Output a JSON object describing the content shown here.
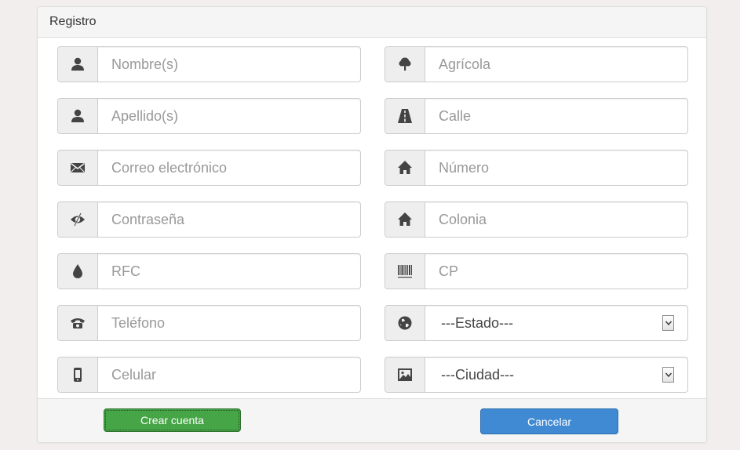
{
  "panel": {
    "title": "Registro"
  },
  "left_fields": [
    {
      "icon": "user-icon",
      "placeholder": "Nombre(s)"
    },
    {
      "icon": "user-icon",
      "placeholder": "Apellido(s)"
    },
    {
      "icon": "envelope-icon",
      "placeholder": "Correo electrónico"
    },
    {
      "icon": "eye-slash-icon",
      "placeholder": "Contraseña"
    },
    {
      "icon": "drop-icon",
      "placeholder": "RFC"
    },
    {
      "icon": "phone-icon",
      "placeholder": "Teléfono"
    },
    {
      "icon": "mobile-phone-icon",
      "placeholder": "Celular"
    }
  ],
  "right_fields": [
    {
      "icon": "tree-icon",
      "placeholder": "Agrícola"
    },
    {
      "icon": "road-icon",
      "placeholder": "Calle"
    },
    {
      "icon": "home-icon",
      "placeholder": "Número"
    },
    {
      "icon": "home-icon",
      "placeholder": "Colonia"
    },
    {
      "icon": "barcode-icon",
      "placeholder": "CP"
    }
  ],
  "selects": {
    "estado": {
      "icon": "globe-icon",
      "value": "---Estado---"
    },
    "ciudad": {
      "icon": "picture-icon",
      "value": "---Ciudad---"
    }
  },
  "buttons": {
    "create_label": "Crear cuenta",
    "cancel_label": "Cancelar"
  },
  "colors": {
    "create_button": "#46a546",
    "cancel_button": "#3f8ad3",
    "icon": "#444444"
  }
}
